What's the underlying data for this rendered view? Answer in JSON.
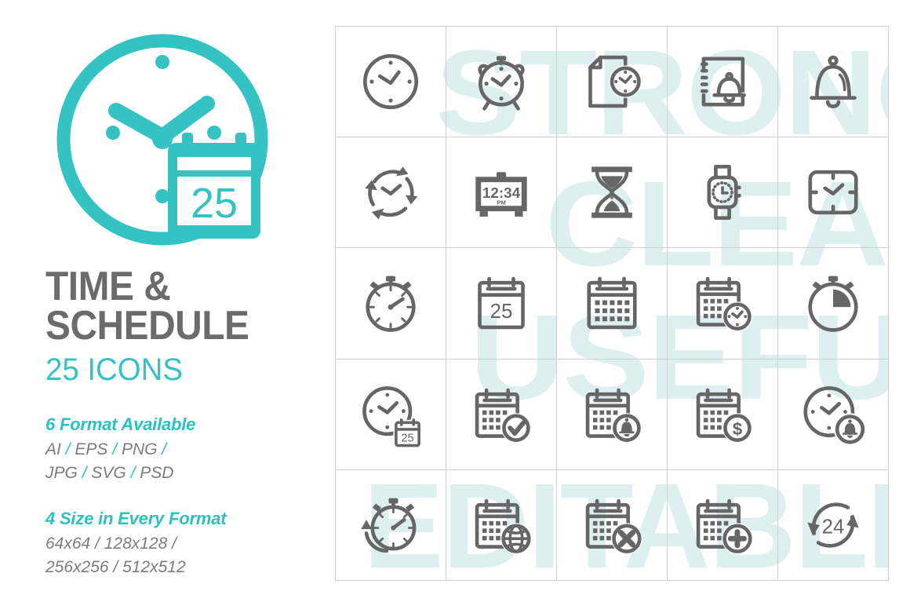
{
  "brand": {
    "accent": "#35c2c2",
    "accent_dark": "#2cc1bd",
    "title_gray": "#6b6b6b",
    "icon_gray": "#666666",
    "watermark": "#ddf0ef",
    "grid_line": "#cfcfcf"
  },
  "logo": {
    "name": "clock-calendar-logo",
    "calendar_day": "25"
  },
  "header": {
    "title_line1": "TIME &",
    "title_line2": "SCHEDULE",
    "subtitle": "25 ICONS"
  },
  "info": {
    "formats_heading": "6 Format Available",
    "formats_line1_parts": [
      "AI",
      "/",
      "EPS",
      "/",
      "PNG",
      "/"
    ],
    "formats_line2_parts": [
      "JPG",
      "/",
      "SVG",
      "/",
      "PSD"
    ],
    "formats_line1": "AI / EPS / PNG /",
    "formats_line2": "JPG / SVG / PSD",
    "sizes_heading": "4 Size in Every Format",
    "sizes_line1": "64x64 / 128x128 /",
    "sizes_line2": "256x256 / 512x512"
  },
  "watermarks": [
    {
      "text": "STRONG",
      "row": 1
    },
    {
      "text": "CLEAR",
      "row": 2
    },
    {
      "text": "USEFUL",
      "row": 3
    },
    {
      "text": "EDITABLE",
      "row": 5
    }
  ],
  "icon_grid": {
    "columns": 5,
    "rows": 5,
    "count": 25,
    "icons": [
      {
        "index": 1,
        "name": "wall-clock-icon",
        "label": "Wall clock"
      },
      {
        "index": 2,
        "name": "alarm-clock-icon",
        "label": "Alarm clock"
      },
      {
        "index": 3,
        "name": "document-clock-icon",
        "label": "Document with clock"
      },
      {
        "index": 4,
        "name": "notebook-bell-icon",
        "label": "Notebook with bell"
      },
      {
        "index": 5,
        "name": "bell-icon",
        "label": "Bell"
      },
      {
        "index": 6,
        "name": "clock-refresh-icon",
        "label": "Clock refresh"
      },
      {
        "index": 7,
        "name": "digital-clock-icon",
        "label": "Digital clock",
        "display_time": "12:34",
        "display_meridiem": "PM"
      },
      {
        "index": 8,
        "name": "hourglass-icon",
        "label": "Hourglass"
      },
      {
        "index": 9,
        "name": "smartwatch-icon",
        "label": "Smart watch"
      },
      {
        "index": 10,
        "name": "square-clock-icon",
        "label": "Square clock"
      },
      {
        "index": 11,
        "name": "stopwatch-icon",
        "label": "Stopwatch"
      },
      {
        "index": 12,
        "name": "calendar-day-icon",
        "label": "Calendar day",
        "day": "25"
      },
      {
        "index": 13,
        "name": "calendar-month-icon",
        "label": "Calendar month"
      },
      {
        "index": 14,
        "name": "calendar-clock-icon",
        "label": "Calendar with clock"
      },
      {
        "index": 15,
        "name": "timer-quarter-icon",
        "label": "Timer quarter"
      },
      {
        "index": 16,
        "name": "clock-calendar-icon",
        "label": "Clock with calendar",
        "day": "25"
      },
      {
        "index": 17,
        "name": "calendar-check-icon",
        "label": "Calendar check"
      },
      {
        "index": 18,
        "name": "calendar-bell-icon",
        "label": "Calendar reminder"
      },
      {
        "index": 19,
        "name": "calendar-dollar-icon",
        "label": "Calendar payment",
        "symbol": "$"
      },
      {
        "index": 20,
        "name": "clock-bell-icon",
        "label": "Clock with bell"
      },
      {
        "index": 21,
        "name": "stopwatch-refresh-icon",
        "label": "Stopwatch refresh"
      },
      {
        "index": 22,
        "name": "calendar-globe-icon",
        "label": "Calendar global"
      },
      {
        "index": 23,
        "name": "calendar-cancel-icon",
        "label": "Calendar cancel"
      },
      {
        "index": 24,
        "name": "calendar-add-icon",
        "label": "Calendar add"
      },
      {
        "index": 25,
        "name": "twentyfour-hours-icon",
        "label": "24 hours",
        "number": "24"
      }
    ]
  }
}
